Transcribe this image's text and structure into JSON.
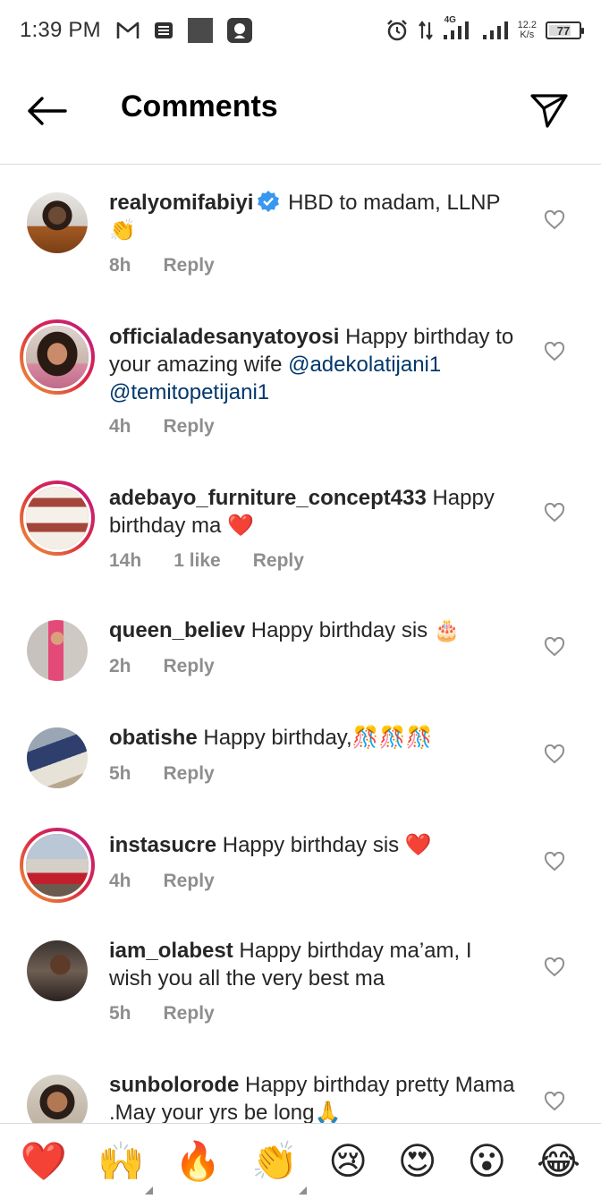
{
  "status_bar": {
    "time": "1:39 PM",
    "network": "4G",
    "speed_value": "12.2",
    "speed_unit": "K/s",
    "battery": "77",
    "battery_level": 0.77
  },
  "header": {
    "title": "Comments"
  },
  "comments": [
    {
      "username": "realyomifabiyi",
      "verified": true,
      "text": "HBD to madam, LLNP",
      "emoji": "👏",
      "time": "8h",
      "likes": "",
      "reply": "Reply"
    },
    {
      "username": "officialadesanyatoyosi",
      "text": "Happy birthday to your amazing wife",
      "mentions": [
        "@adekolatijani1",
        "@temitopetijani1"
      ],
      "time": "4h",
      "likes": "",
      "reply": "Reply"
    },
    {
      "username": "adebayo_furniture_concept433",
      "text": "Happy birthday ma",
      "emoji": "❤️",
      "time": "14h",
      "likes": "1 like",
      "reply": "Reply"
    },
    {
      "username": "queen_believ",
      "text": "Happy birthday sis",
      "emoji": "🎂",
      "time": "2h",
      "likes": "",
      "reply": "Reply"
    },
    {
      "username": "obatishe",
      "text": "Happy birthday,",
      "emoji": "🎊🎊🎊",
      "time": "5h",
      "likes": "",
      "reply": "Reply"
    },
    {
      "username": "instasucre",
      "text": "Happy birthday sis",
      "emoji": "❤️",
      "time": "4h",
      "likes": "",
      "reply": "Reply"
    },
    {
      "username": "iam_olabest",
      "text": "Happy birthday ma’am, I wish you all the very best ma",
      "time": "5h",
      "likes": "",
      "reply": "Reply"
    },
    {
      "username": "sunbolorode",
      "text": "Happy birthday pretty Mama .May your yrs be long",
      "emoji": "🙏",
      "time": "",
      "likes": "",
      "reply": ""
    }
  ],
  "emoji_bar": [
    "❤️",
    "🙌",
    "🔥",
    "👏",
    "😢",
    "😍",
    "😮",
    "😂"
  ],
  "colors": {
    "accent_link": "#00376b",
    "meta_gray": "#8e8e8e",
    "divider": "#dbdbdb",
    "verified_blue": "#3897f0"
  }
}
